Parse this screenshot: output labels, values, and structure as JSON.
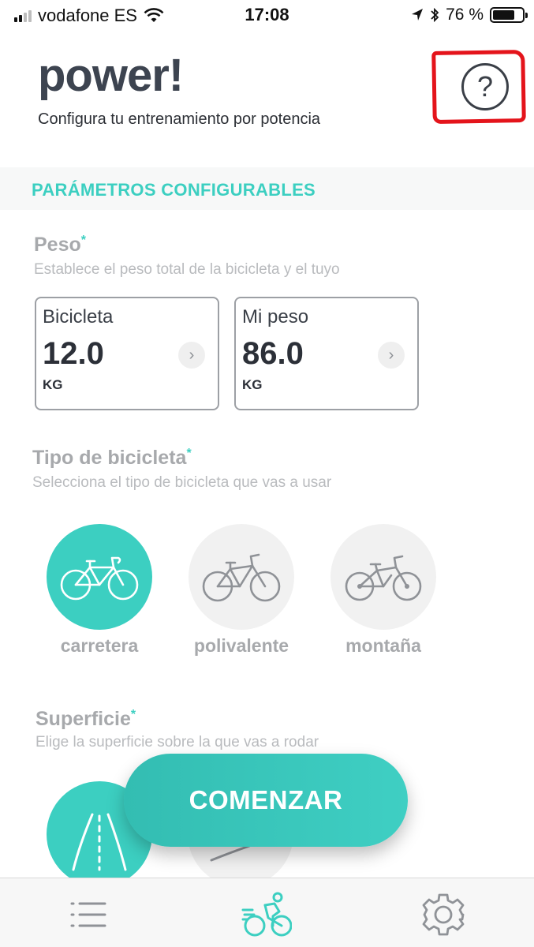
{
  "status_bar": {
    "carrier": "vodafone ES",
    "time": "17:08",
    "battery_percent": "76 %",
    "battery_level": 0.76
  },
  "header": {
    "title": "power!",
    "subtitle": "Configura tu entrenamiento por potencia",
    "help_symbol": "?"
  },
  "section": {
    "title": "PARÁMETROS CONFIGURABLES"
  },
  "weight": {
    "label": "Peso",
    "required_mark": "*",
    "hint": "Establece el peso total de la bicicleta y el tuyo",
    "cards": [
      {
        "caption": "Bicicleta",
        "value": "12.0",
        "unit": "KG"
      },
      {
        "caption": "Mi peso",
        "value": "86.0",
        "unit": "KG"
      }
    ]
  },
  "bike_type": {
    "label": "Tipo de bicicleta",
    "required_mark": "*",
    "hint": "Selecciona el tipo de bicicleta que vas a usar",
    "options": [
      {
        "label": "carretera",
        "selected": true
      },
      {
        "label": "polivalente",
        "selected": false
      },
      {
        "label": "montaña",
        "selected": false
      }
    ]
  },
  "surface": {
    "label": "Superficie",
    "required_mark": "*",
    "hint": "Elige la superficie sobre la que vas a rodar"
  },
  "cta": {
    "label": "COMENZAR"
  },
  "colors": {
    "accent": "#3ccfc1",
    "highlight": "#e4141b",
    "title_text": "#3d4450"
  },
  "tab_bar": {
    "items": [
      {
        "icon": "list-icon"
      },
      {
        "icon": "cyclist-icon",
        "active": true
      },
      {
        "icon": "gear-icon"
      }
    ]
  }
}
